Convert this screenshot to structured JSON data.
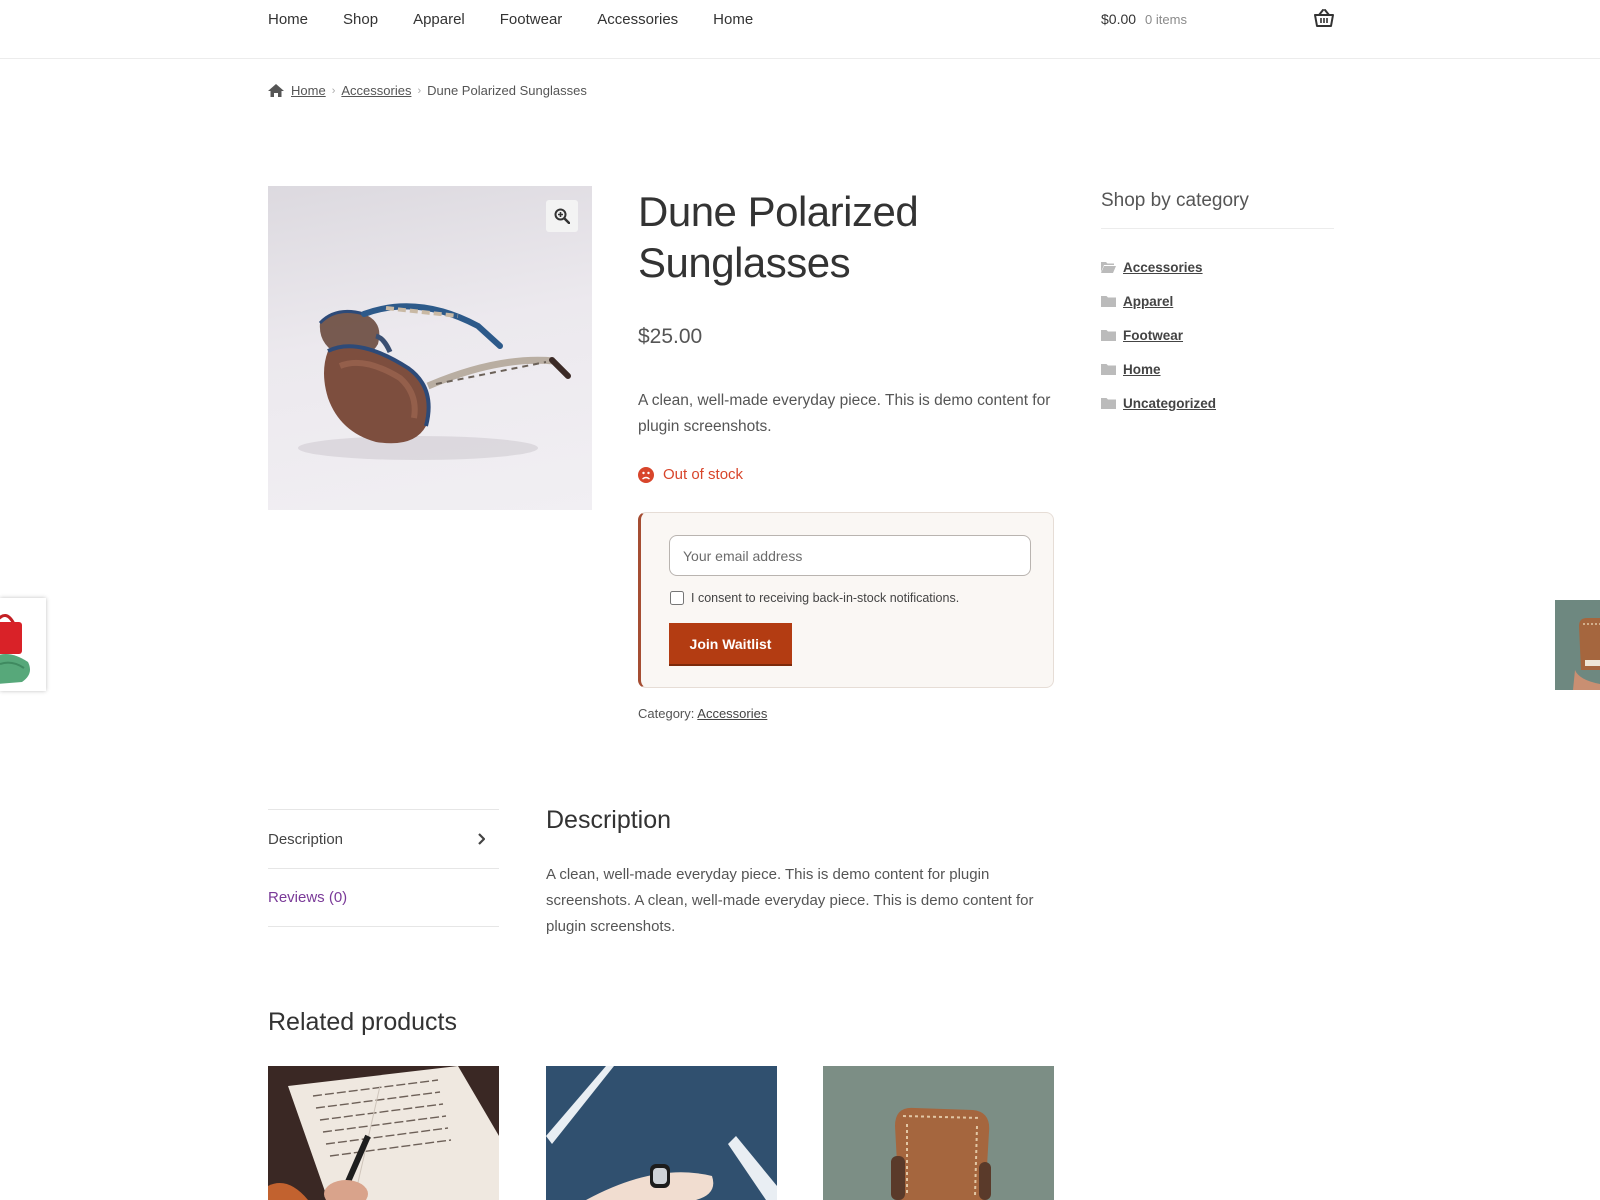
{
  "nav": {
    "items": [
      "Home",
      "Shop",
      "Apparel",
      "Footwear",
      "Accessories",
      "Home"
    ]
  },
  "cart": {
    "amount": "$0.00",
    "count": "0 items",
    "icon": "basket-icon"
  },
  "breadcrumb": {
    "home": "Home",
    "category": "Accessories",
    "current": "Dune Polarized Sunglasses"
  },
  "product": {
    "title": "Dune Polarized Sunglasses",
    "price": "$25.00",
    "short_description": "A clean, well-made everyday piece. This is demo content for plugin screenshots.",
    "stock_status": "Out of stock",
    "category_label": "Category:",
    "category": "Accessories"
  },
  "waitlist": {
    "email_placeholder": "Your email address",
    "consent_label": "I consent to receiving back-in-stock notifications.",
    "button_label": "Join Waitlist",
    "accent_color": "#b33c12"
  },
  "sidebar": {
    "title": "Shop by category",
    "categories": [
      "Accessories",
      "Apparel",
      "Footwear",
      "Home",
      "Uncategorized"
    ]
  },
  "tabs": {
    "description_tab": "Description",
    "reviews_tab": "Reviews (0)"
  },
  "description": {
    "heading": "Description",
    "body": "A clean, well-made everyday piece. This is demo content for plugin screenshots. A clean, well-made everyday piece. This is demo content for plugin screenshots."
  },
  "related": {
    "title": "Related products"
  }
}
